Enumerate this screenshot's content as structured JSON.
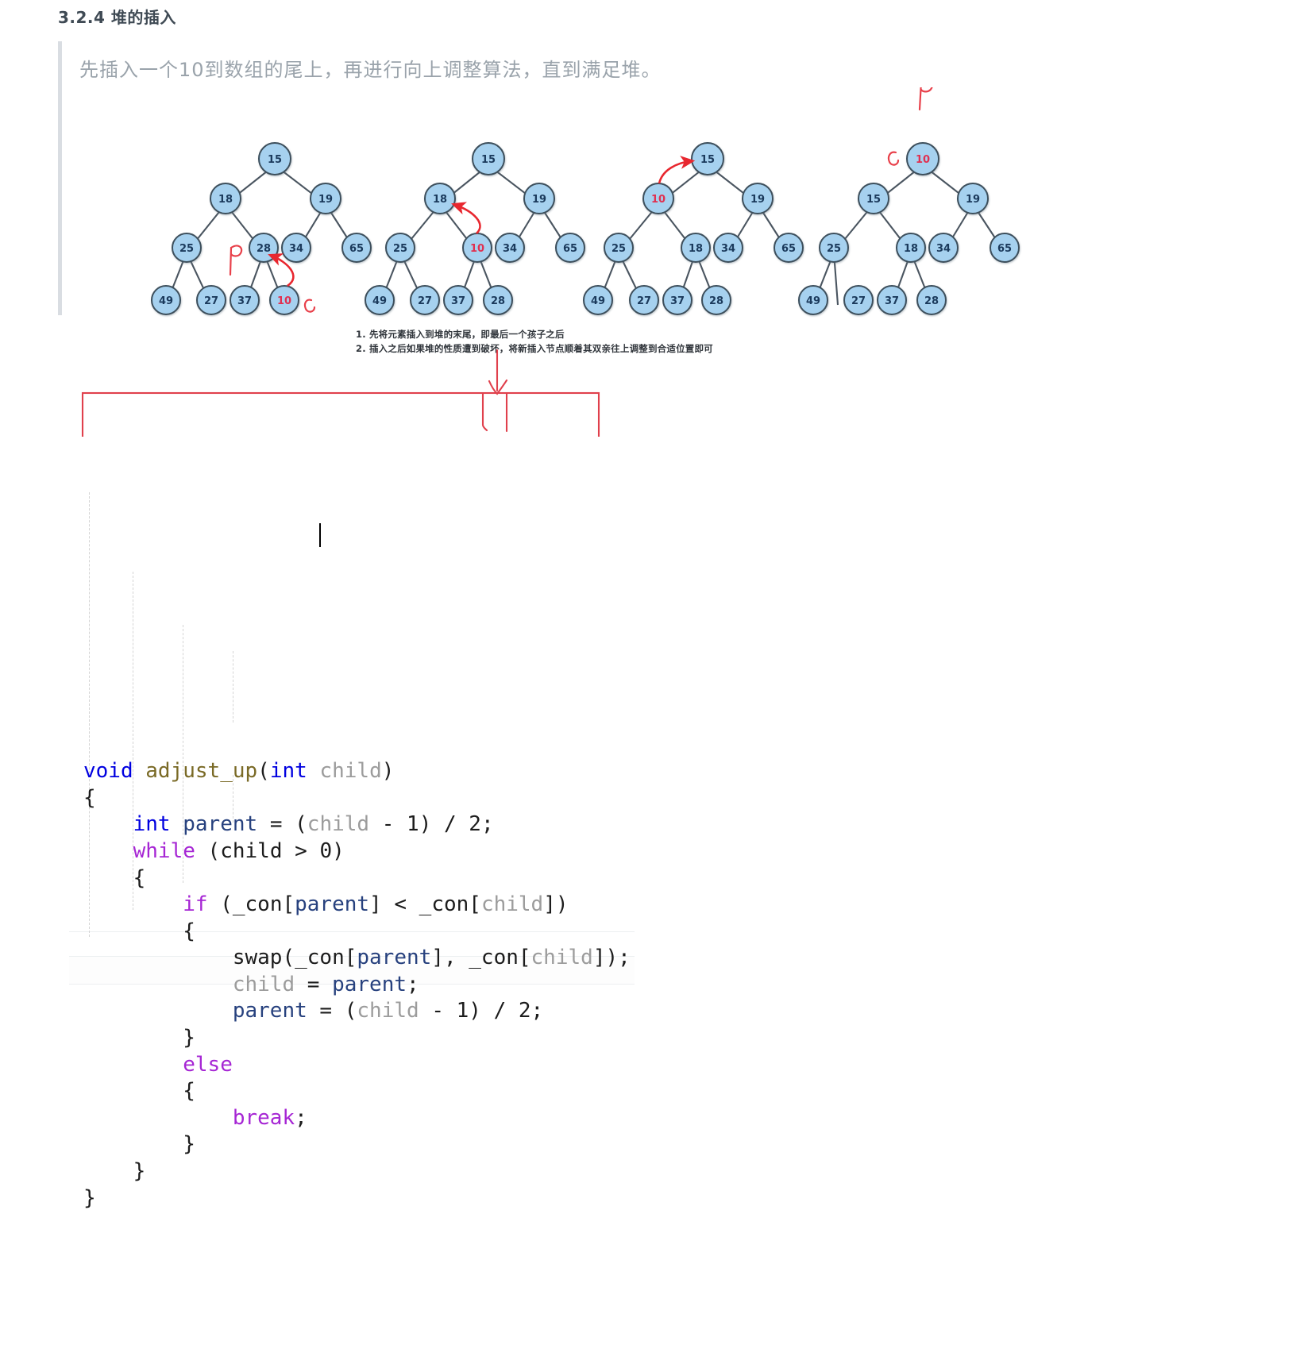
{
  "document": {
    "section_number": "3.2.4",
    "section_title": "3.2.4 堆的插入",
    "quote": "先插入一个10到数组的尾上，再进行向上调整算法，直到满足堆。",
    "caption_lines": [
      "1. 先将元素插入到堆的末尾，即最后一个孩子之后",
      "2. 插入之后如果堆的性质遭到破坏，将新插入节点顺着其双亲往上调整到合适位置即可"
    ]
  },
  "colors": {
    "node_fill": "#a6d1ef",
    "node_stroke": "#3d4f5c",
    "node_text": "#1b3a5c",
    "highlight_text": "#e03050",
    "edge": "#4a5560",
    "arrow_red": "#e8272f",
    "annotation_red": "#e8404a",
    "quote_bar": "#d9dde2",
    "quote_text": "#9aa3ab",
    "title_text": "#3f4a54"
  },
  "figure": {
    "type": "heap-insert-sequence",
    "trees": [
      {
        "name": "step-1-insert-at-tail",
        "levels": [
          [
            "15"
          ],
          [
            "18",
            "19"
          ],
          [
            "25",
            "28",
            "34",
            "65"
          ],
          [
            "49",
            "27",
            "37",
            "10"
          ]
        ],
        "highlight": [
          "10"
        ],
        "arrow": "from 10 to 28",
        "hand_labels": [
          {
            "text": "p",
            "near": "28"
          },
          {
            "text": "c",
            "near": "10"
          }
        ]
      },
      {
        "name": "step-2-swap-10-and-28",
        "levels": [
          [
            "15"
          ],
          [
            "18",
            "19"
          ],
          [
            "25",
            "10",
            "34",
            "65"
          ],
          [
            "49",
            "27",
            "37",
            "28"
          ]
        ],
        "highlight": [
          "10"
        ],
        "arrow": "from 10 to 18",
        "hand_labels": []
      },
      {
        "name": "step-3-swap-10-and-18",
        "levels": [
          [
            "15"
          ],
          [
            "10",
            "19"
          ],
          [
            "25",
            "18",
            "34",
            "65"
          ],
          [
            "49",
            "27",
            "37",
            "28"
          ]
        ],
        "highlight": [
          "10"
        ],
        "arrow": "from 10 to 15",
        "hand_labels": []
      },
      {
        "name": "step-4-swap-10-and-15",
        "levels": [
          [
            "10"
          ],
          [
            "15",
            "19"
          ],
          [
            "25",
            "18",
            "34",
            "65"
          ],
          [
            "49",
            "27",
            "37",
            "28"
          ]
        ],
        "highlight": [
          "10"
        ],
        "arrow": "",
        "hand_labels": [
          {
            "text": "p",
            "near": "top"
          },
          {
            "text": "c",
            "near": "10"
          }
        ]
      }
    ]
  },
  "annotation": {
    "name": "red-array-box-with-arrow",
    "arrow_direction": "down",
    "cells": 2
  },
  "code": {
    "language": "cpp",
    "caret_line": 3,
    "lines": [
      [
        {
          "t": "void",
          "c": "kw-blue"
        },
        {
          "t": " ",
          "c": "plain"
        },
        {
          "t": "adjust_up",
          "c": "fn"
        },
        {
          "t": "(",
          "c": "plain"
        },
        {
          "t": "int",
          "c": "kw-blue"
        },
        {
          "t": " ",
          "c": "plain"
        },
        {
          "t": "child",
          "c": "var-gray"
        },
        {
          "t": ")",
          "c": "plain"
        }
      ],
      [
        {
          "t": "{",
          "c": "plain"
        }
      ],
      [
        {
          "t": "    ",
          "c": "plain"
        },
        {
          "t": "int",
          "c": "kw-blue"
        },
        {
          "t": " ",
          "c": "plain"
        },
        {
          "t": "parent",
          "c": "var-navy"
        },
        {
          "t": " = (",
          "c": "plain"
        },
        {
          "t": "child",
          "c": "var-gray"
        },
        {
          "t": " - 1) / 2;",
          "c": "plain"
        }
      ],
      [
        {
          "t": "    ",
          "c": "plain"
        },
        {
          "t": "while",
          "c": "kw-purple"
        },
        {
          "t": " (child > 0)",
          "c": "plain"
        }
      ],
      [
        {
          "t": "    {",
          "c": "plain"
        }
      ],
      [
        {
          "t": "        ",
          "c": "plain"
        },
        {
          "t": "if",
          "c": "kw-purple"
        },
        {
          "t": " (_con[",
          "c": "plain"
        },
        {
          "t": "parent",
          "c": "var-navy"
        },
        {
          "t": "] < _con[",
          "c": "plain"
        },
        {
          "t": "child",
          "c": "var-gray"
        },
        {
          "t": "])",
          "c": "plain"
        }
      ],
      [
        {
          "t": "        {",
          "c": "plain"
        }
      ],
      [
        {
          "t": "            swap(_con[",
          "c": "plain"
        },
        {
          "t": "parent",
          "c": "var-navy"
        },
        {
          "t": "], _con[",
          "c": "plain"
        },
        {
          "t": "child",
          "c": "var-gray"
        },
        {
          "t": "]);",
          "c": "plain"
        }
      ],
      [
        {
          "t": "            ",
          "c": "plain"
        },
        {
          "t": "child",
          "c": "var-gray"
        },
        {
          "t": " = ",
          "c": "plain"
        },
        {
          "t": "parent",
          "c": "var-navy"
        },
        {
          "t": ";",
          "c": "plain"
        }
      ],
      [
        {
          "t": "            ",
          "c": "plain"
        },
        {
          "t": "parent",
          "c": "var-navy"
        },
        {
          "t": " = (",
          "c": "plain"
        },
        {
          "t": "child",
          "c": "var-gray"
        },
        {
          "t": " - 1) / 2;",
          "c": "plain"
        }
      ],
      [
        {
          "t": "        }",
          "c": "plain"
        }
      ],
      [
        {
          "t": "        ",
          "c": "plain"
        },
        {
          "t": "else",
          "c": "kw-purple"
        }
      ],
      [
        {
          "t": "        {",
          "c": "plain"
        }
      ],
      [
        {
          "t": "            ",
          "c": "plain"
        },
        {
          "t": "break",
          "c": "kw-purple"
        },
        {
          "t": ";",
          "c": "plain"
        }
      ],
      [
        {
          "t": "        }",
          "c": "plain"
        }
      ],
      [
        {
          "t": "    }",
          "c": "plain"
        }
      ],
      [
        {
          "t": "}",
          "c": "plain"
        }
      ]
    ]
  }
}
